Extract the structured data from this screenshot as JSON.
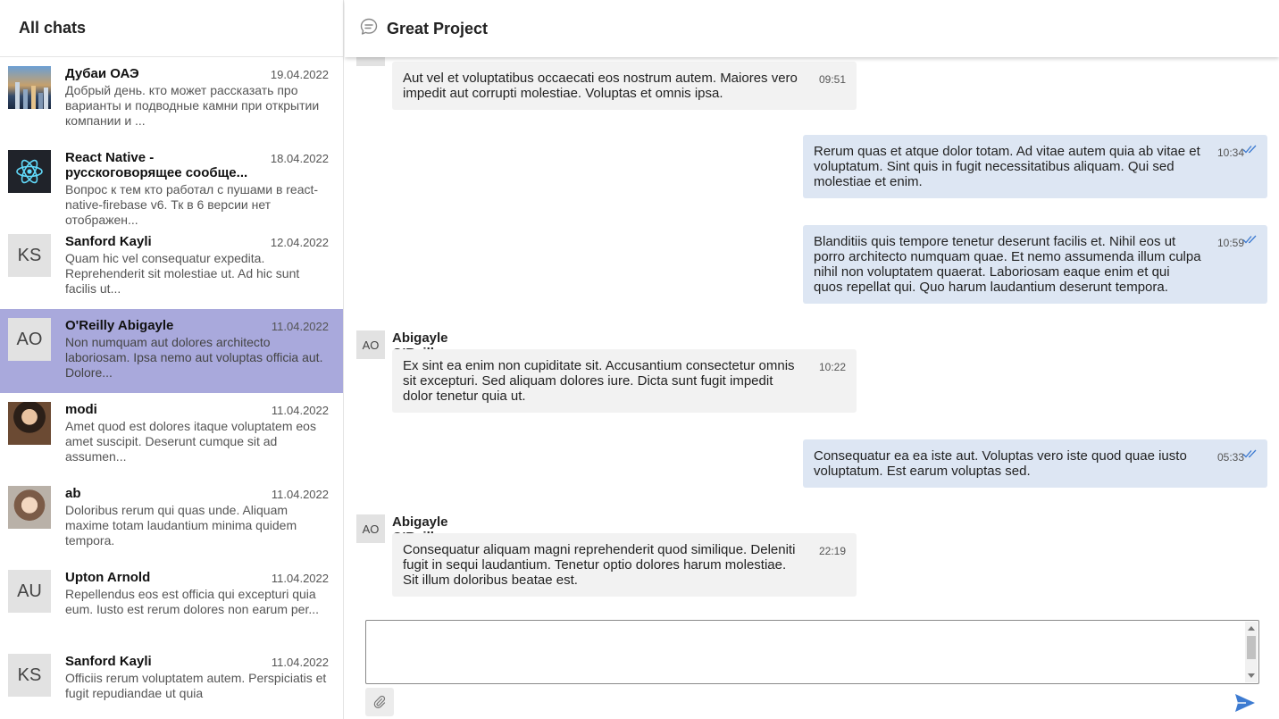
{
  "sidebar": {
    "title": "All chats",
    "chats": [
      {
        "name": "Дубаи ОАЭ",
        "date": "19.04.2022",
        "preview": "Добрый день. кто может рассказать про варианты и подводные камни при открытии компании и ...",
        "avatar": "city-photo"
      },
      {
        "name": "React Native - русскоговорящее сообще...",
        "date": "18.04.2022",
        "preview": "Вопрос к тем кто работал с пушами в react-native-firebase v6. Тк в 6 версии нет отображен...",
        "avatar": "react-logo"
      },
      {
        "name": "Sanford Kayli",
        "date": "12.04.2022",
        "preview": "Quam hic vel consequatur expedita. Reprehenderit sit molestiae ut. Ad hic sunt facilis ut...",
        "initials": "KS"
      },
      {
        "name": "O'Reilly Abigayle",
        "date": "11.04.2022",
        "preview": "Non numquam aut dolores architecto laboriosam. Ipsa nemo aut voluptas officia aut. Dolore...",
        "initials": "AO",
        "active": true
      },
      {
        "name": "modi",
        "date": "11.04.2022",
        "preview": "Amet quod est dolores itaque voluptatem eos amet suscipit. Deserunt cumque sit ad assumen...",
        "avatar": "person-photo"
      },
      {
        "name": "ab",
        "date": "11.04.2022",
        "preview": "Doloribus rerum qui quas unde. Aliquam maxime totam laudantium minima quidem tempora.",
        "avatar": "person-photo"
      },
      {
        "name": "Upton Arnold",
        "date": "11.04.2022",
        "preview": "Repellendus eos est officia qui excepturi quia eum. Iusto est rerum dolores non earum per...",
        "initials": "AU"
      },
      {
        "name": "Sanford Kayli",
        "date": "11.04.2022",
        "preview": "Officiis rerum voluptatem autem. Perspiciatis et fugit repudiandae ut quia",
        "initials": "KS"
      }
    ]
  },
  "chat": {
    "title": "Great Project",
    "icon": "chat-bubble-icon",
    "messages": [
      {
        "direction": "in",
        "initials": "AO",
        "text": "Aut vel et voluptatibus occaecati eos nostrum autem. Maiores vero impedit aut corrupti molestiae. Voluptas et omnis ipsa.",
        "time": "09:51"
      },
      {
        "direction": "out",
        "text": "Rerum quas et atque dolor totam. Ad vitae autem quia ab vitae et voluptatum. Sint quis in fugit necessitatibus aliquam. Qui sed molestiae et enim.",
        "time": "10:34"
      },
      {
        "direction": "out",
        "text": "Blanditiis quis tempore tenetur deserunt facilis et. Nihil eos ut porro architecto numquam quae. Et nemo assumenda illum culpa nihil non voluptatem quaerat. Laboriosam eaque enim et qui quos repellat qui. Quo harum laudantium deserunt tempora.",
        "time": "10:59"
      },
      {
        "direction": "in",
        "sender": "Abigayle O'Reilly",
        "initials": "AO",
        "text": "Ex sint ea enim non cupiditate sit. Accusantium consectetur omnis sit excepturi. Sed aliquam dolores iure. Dicta sunt fugit impedit dolor tenetur quia ut.",
        "time": "10:22"
      },
      {
        "direction": "out",
        "text": "Consequatur ea ea iste aut. Voluptas vero iste quod quae iusto voluptatum. Est earum voluptas sed.",
        "time": "05:33"
      },
      {
        "direction": "in",
        "sender": "Abigayle O'Reilly",
        "initials": "AO",
        "text": "Consequatur aliquam magni reprehenderit quod similique. Deleniti fugit in sequi laudantium. Tenetur optio dolores harum molestiae. Sit illum doloribus beatae est.",
        "time": "22:19"
      }
    ]
  },
  "composer": {
    "value": "",
    "attach_icon": "paperclip-icon",
    "send_icon": "send-icon"
  },
  "colors": {
    "active_chat": "#a9a9dc",
    "incoming_bubble": "#f2f2f2",
    "outgoing_bubble": "#dde6f3",
    "accent": "#3d7bd1"
  }
}
